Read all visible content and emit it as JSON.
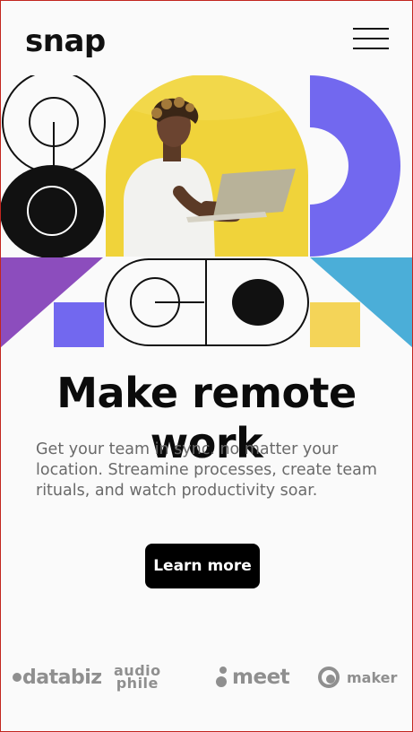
{
  "header": {
    "logo": "snap",
    "menu_icon": "hamburger-icon"
  },
  "hero": {
    "headline": "Make remote work",
    "description": "Get your team in sync. no matter your location. Streamine processes, create team rituals, and watch productivity soar.",
    "cta_label": "Learn more"
  },
  "clients": {
    "databiz": "databiz",
    "audiophile_top": "audio",
    "audiophile_bottom": "phile",
    "meet": "meet",
    "maker": "maker"
  },
  "colors": {
    "purple": "#7268ef",
    "yellow": "#f4d458",
    "blue": "#4baed8",
    "violet": "#8c4dbd",
    "black": "#111111"
  }
}
